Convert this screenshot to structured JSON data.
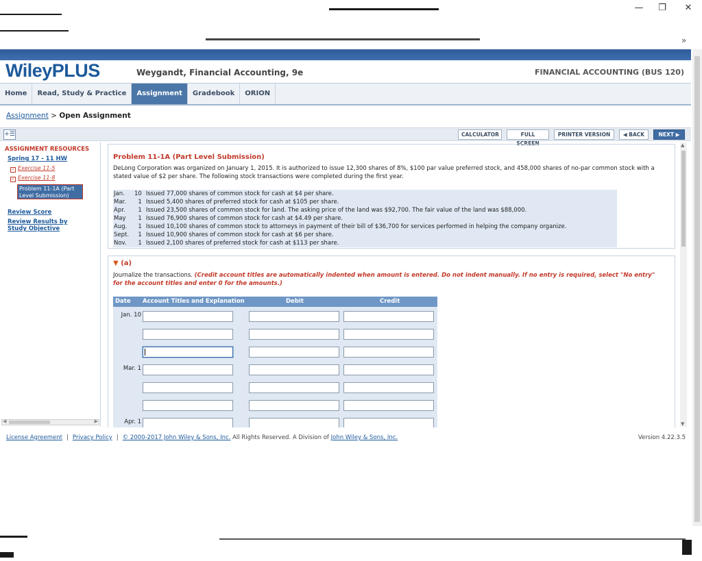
{
  "window": {
    "minimize_glyph": "—",
    "restore_glyph": "❐",
    "close_glyph": "✕",
    "overflow_glyph": "»"
  },
  "header": {
    "logo": "WileyPLUS",
    "course_title": "Weygandt, Financial Accounting, 9e",
    "course_code": "FINANCIAL ACCOUNTING (BUS 120)"
  },
  "tabs": [
    {
      "label": "Home",
      "active": false
    },
    {
      "label": "Read, Study & Practice",
      "active": false
    },
    {
      "label": "Assignment",
      "active": true
    },
    {
      "label": "Gradebook",
      "active": false
    },
    {
      "label": "ORION",
      "active": false
    }
  ],
  "breadcrumb": {
    "link": "Assignment",
    "sep": ">",
    "current": "Open Assignment"
  },
  "toolbar": {
    "expand_icon": "+☰",
    "calculator": "CALCULATOR",
    "full_screen": "FULL SCREEN",
    "printer_version": "PRINTER VERSION",
    "back": "◀ BACK",
    "next": "NEXT ▶"
  },
  "sidebar": {
    "title": "ASSIGNMENT RESOURCES",
    "assignment_link": "Spring 17 - 11 HW",
    "items": [
      {
        "label": "Exercise 11-5",
        "mark": "✓"
      },
      {
        "label": "Exercise 11-8",
        "mark": "✓"
      }
    ],
    "current": "Problem 11-1A (Part Level Submission)",
    "review_score": "Review Score",
    "review_results": "Review Results by Study Objective"
  },
  "problem": {
    "title": "Problem 11-1A (Part Level Submission)",
    "description": "DeLong Corporation was organized on January 1, 2015. It is authorized to issue 12,300 shares of 8%, $100 par value preferred stock, and 458,000 shares of no-par common stock with a stated value of $2 per share. The following stock transactions were completed during the first year.",
    "transactions": [
      {
        "month": "Jan.",
        "day": "10",
        "text": "Issued 77,000 shares of common stock for cash at $4 per share."
      },
      {
        "month": "Mar.",
        "day": "1",
        "text": "Issued 5,400 shares of preferred stock for cash at $105 per share."
      },
      {
        "month": "Apr.",
        "day": "1",
        "text": "Issued 23,500 shares of common stock for land. The asking price of the land was $92,700. The fair value of the land was $88,000."
      },
      {
        "month": "May",
        "day": "1",
        "text": "Issued 76,900 shares of common stock for cash at $4.49 per share."
      },
      {
        "month": "Aug.",
        "day": "1",
        "text": "Issued 10,100 shares of common stock to attorneys in payment of their bill of $36,700 for services performed in helping the company organize."
      },
      {
        "month": "Sept.",
        "day": "1",
        "text": "Issued 10,900 shares of common stock for cash at $6 per share."
      },
      {
        "month": "Nov.",
        "day": "1",
        "text": "Issued 2,100 shares of preferred stock for cash at $113 per share."
      }
    ]
  },
  "part_a": {
    "label": "(a)",
    "instruction": "Journalize the transactions.",
    "instruction_note": "(Credit account titles are automatically indented when amount is entered. Do not indent manually. If no entry is required, select \"No entry\" for the account titles and enter 0 for the amounts.)",
    "columns": [
      "Date",
      "Account Titles and Explanation",
      "Debit",
      "Credit"
    ],
    "rows": [
      {
        "date": "Jan. 10"
      },
      {
        "date": ""
      },
      {
        "date": "",
        "focused": true
      },
      {
        "date": "Mar. 1"
      },
      {
        "date": ""
      },
      {
        "date": ""
      },
      {
        "date": "Apr. 1"
      }
    ]
  },
  "footer": {
    "license": "License Agreement",
    "privacy": "Privacy Policy",
    "copyright_link": "© 2000-2017 John Wiley & Sons, Inc.",
    "rights": "All Rights Reserved. A Division of",
    "company_link": "John Wiley & Sons, Inc.",
    "version": "Version 4.22.3.5"
  }
}
